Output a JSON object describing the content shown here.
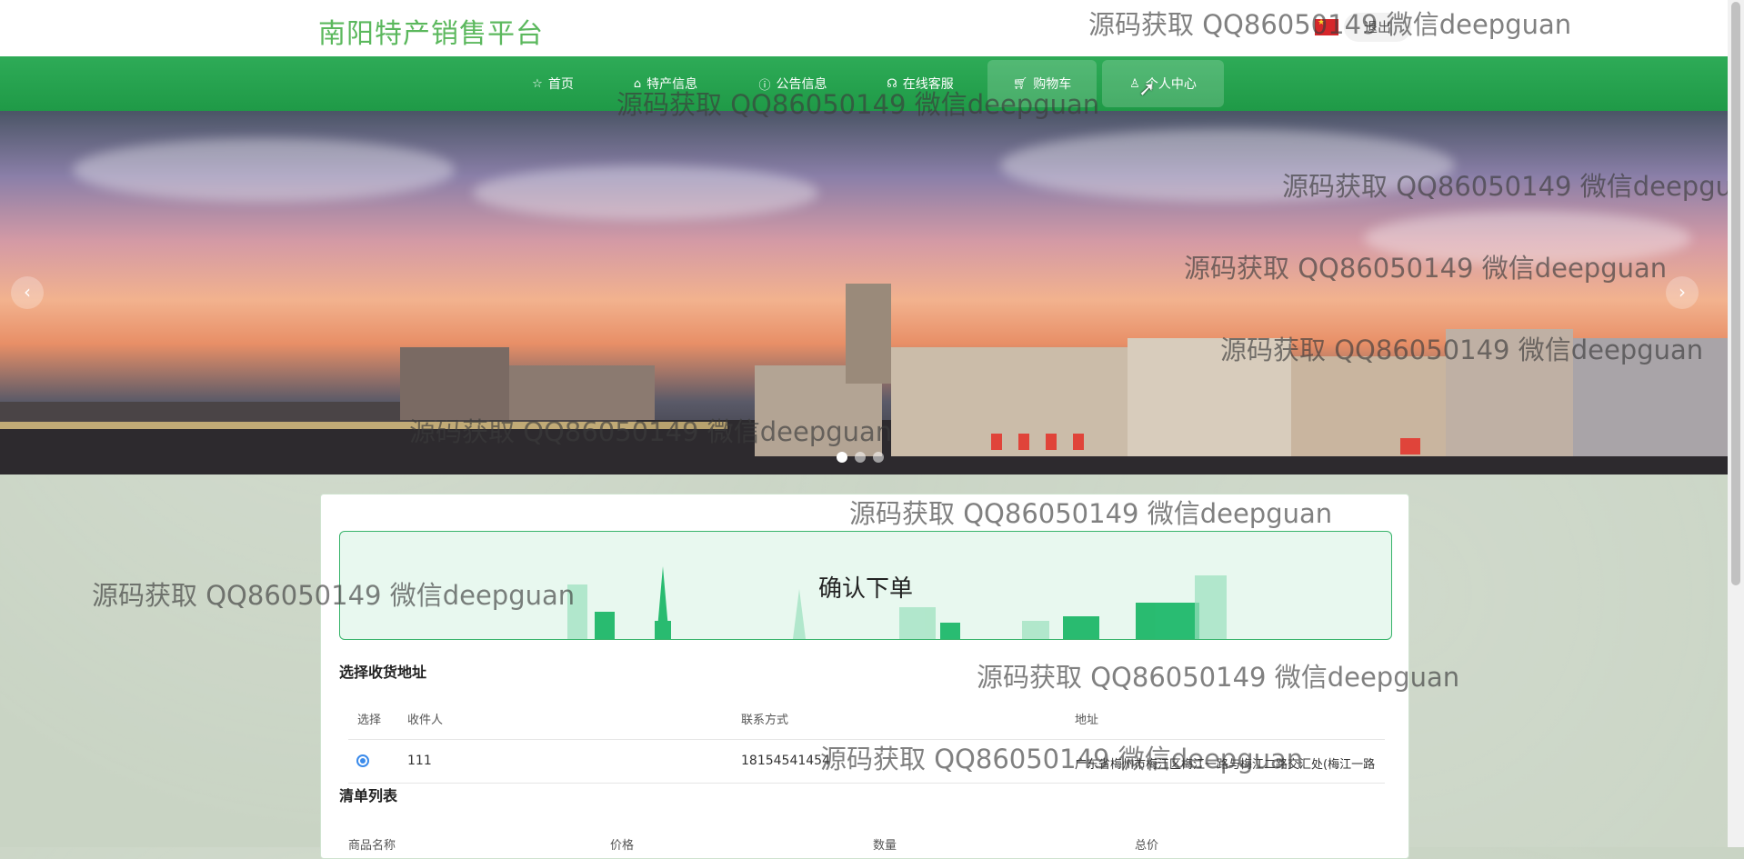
{
  "header": {
    "site_title": "南阳特产销售平台",
    "logout_label": "退出"
  },
  "nav": {
    "items": [
      {
        "label": "首页",
        "icon": "star-icon"
      },
      {
        "label": "特产信息",
        "icon": "bag-icon"
      },
      {
        "label": "公告信息",
        "icon": "info-icon"
      },
      {
        "label": "在线客服",
        "icon": "headset-icon"
      },
      {
        "label": "购物车",
        "icon": "cart-icon"
      },
      {
        "label": "个人中心",
        "icon": "user-icon"
      }
    ]
  },
  "banner": {
    "prev": "‹",
    "next": "›",
    "slides": 3,
    "active_slide": 1
  },
  "order": {
    "title": "确认下单",
    "address_section": "选择收货地址",
    "address_headers": [
      "选择",
      "收件人",
      "联系方式",
      "地址"
    ],
    "address_row": {
      "recipient": "111",
      "phone": "18154541454",
      "address": "广东省梅州市梅江区梅江一路与梅江二路交汇处(梅江一路店)"
    },
    "list_section": "清单列表",
    "list_headers": [
      "商品名称",
      "价格",
      "数量",
      "总价"
    ]
  },
  "watermark": "源码获取 QQ86050149 微信deepguan",
  "colors": {
    "brand_green": "#1f9a47",
    "title_green": "#5bb85d",
    "radio_blue": "#3b8beb"
  }
}
